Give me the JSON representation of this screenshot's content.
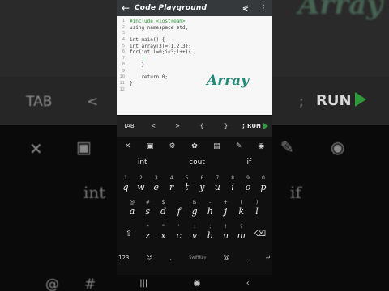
{
  "app": {
    "title": "Code Playground",
    "back_icon": "arrow-left-icon",
    "share_icon": "share-icon",
    "menu_icon": "more-vert-icon"
  },
  "editor": {
    "line_numbers": [
      "1",
      "2",
      "3",
      "4",
      "5",
      "6",
      "7",
      "8",
      "9",
      "10",
      "11",
      "12"
    ],
    "lines": [
      "#include <iostream>",
      "using namespace std;",
      "",
      "int main() {",
      "int array[3]={1,2,3};",
      "for(int i=0;i<3;i++){",
      "    |",
      "    }",
      "",
      "    return 0;",
      "}",
      ""
    ],
    "overlay_text": "Array"
  },
  "toolbar": {
    "tab": "TAB",
    "lt": "<",
    "gt": ">",
    "lbrace": "{",
    "rbrace": "}",
    "semicolon": ";",
    "run": "RUN"
  },
  "keyboard": {
    "top_icons": [
      "close-icon",
      "sticker-icon",
      "gear-icon",
      "palette-icon",
      "clipboard-icon",
      "pin-icon",
      "location-icon"
    ],
    "suggestions": [
      "int",
      "cout",
      "if"
    ],
    "row1": [
      {
        "sym": "1",
        "ch": "q"
      },
      {
        "sym": "2",
        "ch": "w"
      },
      {
        "sym": "3",
        "ch": "e"
      },
      {
        "sym": "4",
        "ch": "r"
      },
      {
        "sym": "5",
        "ch": "t"
      },
      {
        "sym": "6",
        "ch": "y"
      },
      {
        "sym": "7",
        "ch": "u"
      },
      {
        "sym": "8",
        "ch": "i"
      },
      {
        "sym": "9",
        "ch": "o"
      },
      {
        "sym": "0",
        "ch": "p"
      }
    ],
    "row2": [
      {
        "sym": "@",
        "ch": "a"
      },
      {
        "sym": "#",
        "ch": "s"
      },
      {
        "sym": "$",
        "ch": "d"
      },
      {
        "sym": "_",
        "ch": "f"
      },
      {
        "sym": "&",
        "ch": "g"
      },
      {
        "sym": "-",
        "ch": "h"
      },
      {
        "sym": "+",
        "ch": "j"
      },
      {
        "sym": "(",
        "ch": "k"
      },
      {
        "sym": ")",
        "ch": "l"
      }
    ],
    "row3": [
      {
        "sym": "*",
        "ch": "z"
      },
      {
        "sym": "\"",
        "ch": "x"
      },
      {
        "sym": "'",
        "ch": "c"
      },
      {
        "sym": ":",
        "ch": "v"
      },
      {
        "sym": ";",
        "ch": "b"
      },
      {
        "sym": "!",
        "ch": "n"
      },
      {
        "sym": "?",
        "ch": "m"
      }
    ],
    "bottom": {
      "mode": "123",
      "emoji": "☺",
      "comma": ",",
      "space": "SwiftKey",
      "at": "@",
      "period": ".",
      "enter": "↵"
    }
  },
  "background": {
    "logo": "Array",
    "tab": "TAB",
    "lt": "<",
    "semicolon": ";",
    "run": "RUN",
    "word_left": "int",
    "word_right": "if",
    "at": "@",
    "hash": "#"
  },
  "colors": {
    "accent_green": "#2e9a3c",
    "overlay_teal": "#1f8a78",
    "appbar": "#35393c",
    "editor_bg": "#f7f7f7",
    "keyboard_bg": "#101010"
  }
}
